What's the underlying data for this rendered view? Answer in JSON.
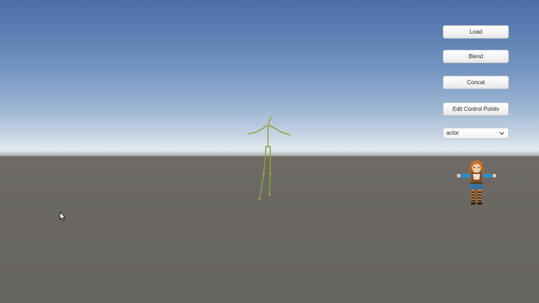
{
  "buttons": {
    "load": "Load",
    "blend": "Blend",
    "concat": "Concat",
    "edit_control_points": "Edit Control Points"
  },
  "dropdown": {
    "selected": "actor",
    "icon": "chevron-down-icon"
  },
  "scene": {
    "sky_color": "#5b7eb3",
    "horizon_color": "#e6edf4",
    "ground_color": "#6a6762",
    "skeleton_color": "#8fa23a"
  }
}
